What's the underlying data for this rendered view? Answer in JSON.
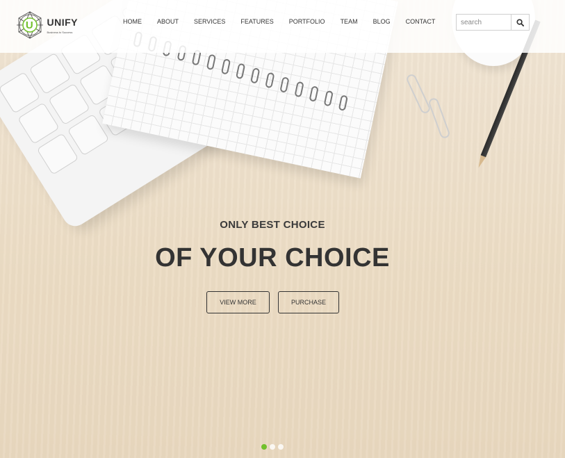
{
  "brand": {
    "name": "UNIFY",
    "tagline": "Business to Success",
    "emblem_letter": "U",
    "accent_color": "#72c02c"
  },
  "nav": {
    "items": [
      {
        "label": "HOME"
      },
      {
        "label": "ABOUT"
      },
      {
        "label": "SERVICES"
      },
      {
        "label": "FEATURES"
      },
      {
        "label": "PORTFOLIO"
      },
      {
        "label": "TEAM"
      },
      {
        "label": "BLOG"
      },
      {
        "label": "CONTACT"
      }
    ]
  },
  "search": {
    "placeholder": "search",
    "value": "",
    "icon": "search-icon"
  },
  "hero": {
    "subtitle": "ONLY BEST CHOICE",
    "title": "OF YOUR CHOICE",
    "buttons": {
      "view_more": "VIEW MORE",
      "purchase": "PURCHASE"
    }
  },
  "slider": {
    "slide_count": 3,
    "active_index": 0
  }
}
